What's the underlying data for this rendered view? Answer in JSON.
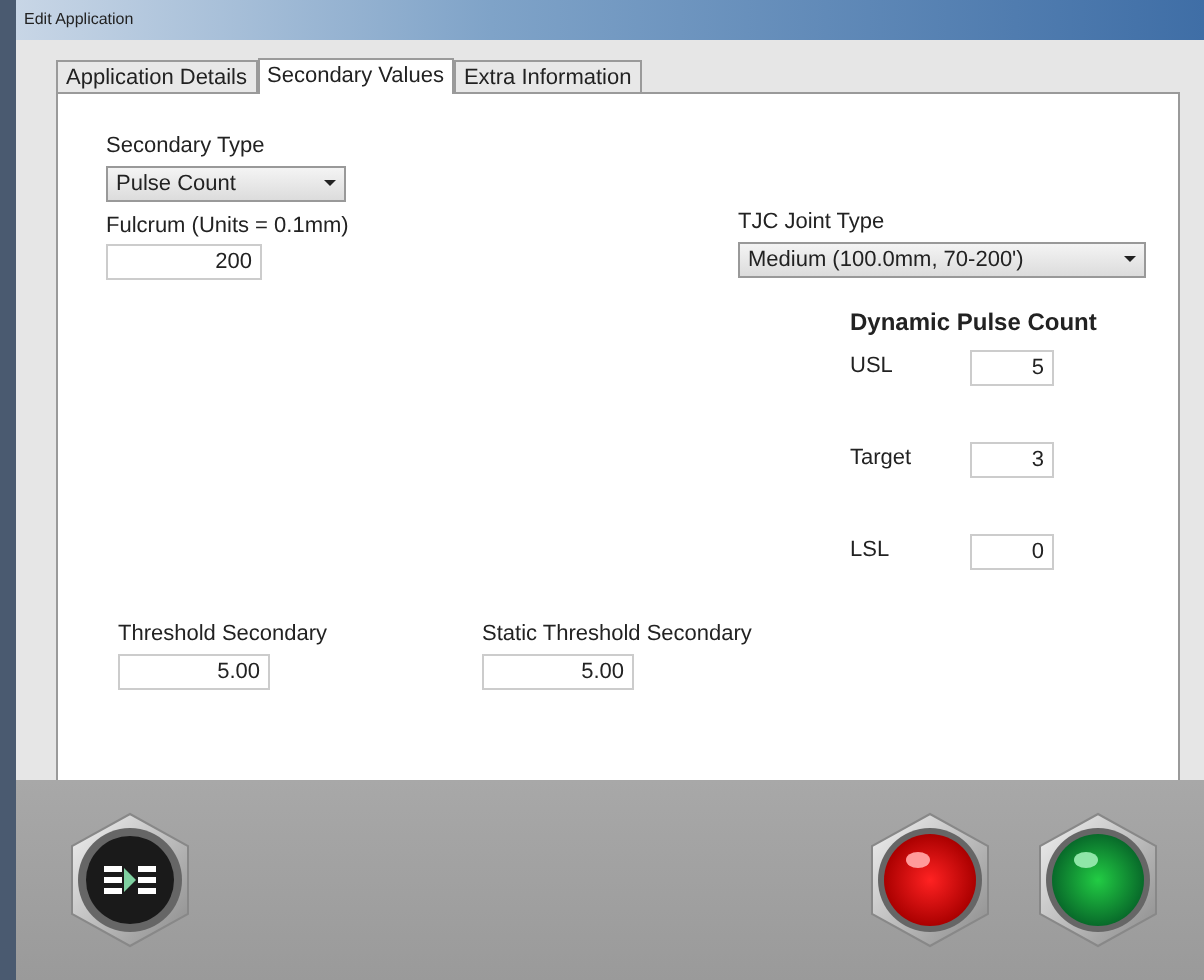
{
  "window": {
    "title": "Edit Application"
  },
  "tabs": [
    {
      "label": "Application Details",
      "selected": false
    },
    {
      "label": "Secondary Values",
      "selected": true
    },
    {
      "label": "Extra Information",
      "selected": false
    }
  ],
  "secondary_type": {
    "label": "Secondary Type",
    "value": "Pulse Count"
  },
  "fulcrum": {
    "label": "Fulcrum (Units = 0.1mm)",
    "value": "200"
  },
  "tjc_joint_type": {
    "label": "TJC Joint Type",
    "value": "Medium (100.0mm, 70-200')"
  },
  "dynamic_pulse_count": {
    "title": "Dynamic Pulse Count",
    "fields": [
      {
        "label": "USL",
        "value": "5"
      },
      {
        "label": "Target",
        "value": "3"
      },
      {
        "label": "LSL",
        "value": "0"
      }
    ]
  },
  "threshold_secondary": {
    "label": "Threshold Secondary",
    "value": "5.00"
  },
  "static_threshold_secondary": {
    "label": "Static Threshold Secondary",
    "value": "5.00"
  },
  "buttons": [
    {
      "kind": "transfer"
    },
    {
      "kind": "red"
    },
    {
      "kind": "green"
    }
  ]
}
